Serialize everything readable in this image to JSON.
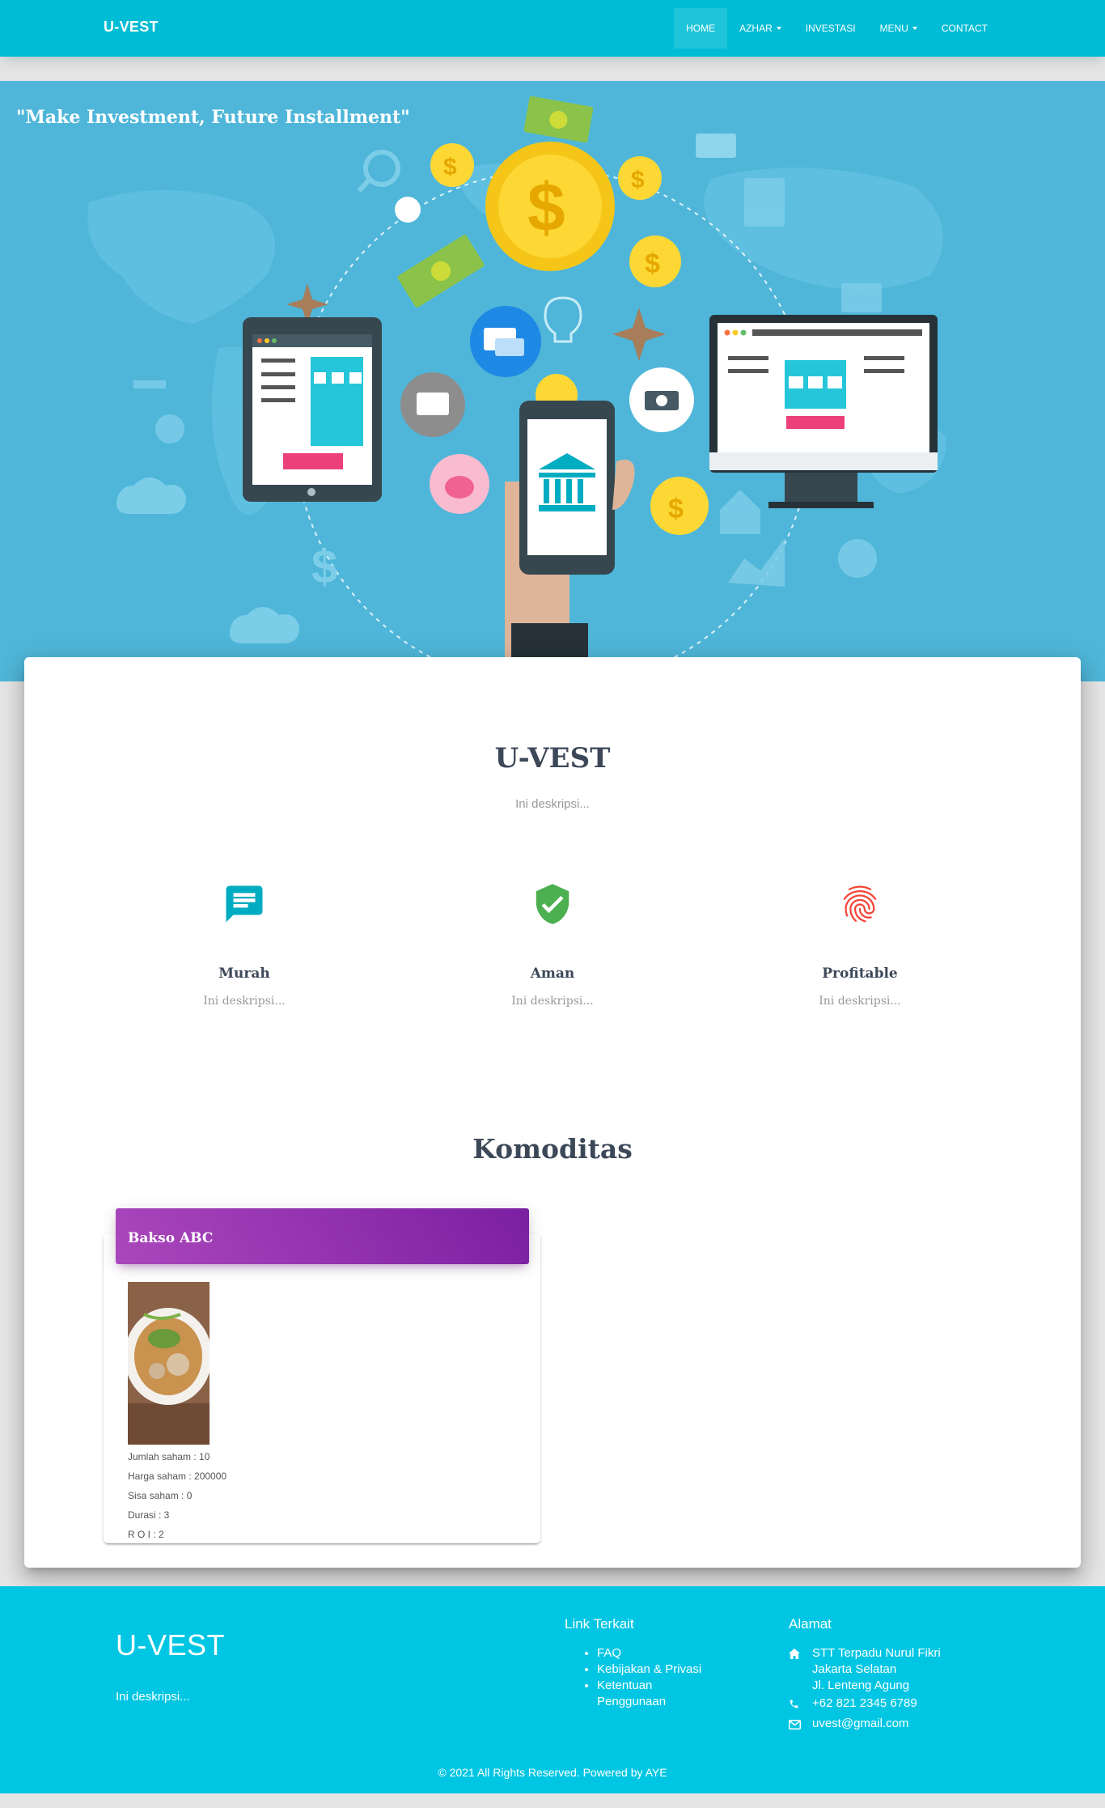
{
  "navbar": {
    "brand": "U-VEST",
    "items": [
      {
        "label": "HOME",
        "active": true,
        "dropdown": false
      },
      {
        "label": "AZHAR",
        "active": false,
        "dropdown": true
      },
      {
        "label": "INVESTASI",
        "active": false,
        "dropdown": false
      },
      {
        "label": "MENU",
        "active": false,
        "dropdown": true
      },
      {
        "label": "CONTACT",
        "active": false,
        "dropdown": false
      }
    ]
  },
  "hero": {
    "quote": "\"Make Investment, Future Installment\""
  },
  "main": {
    "title": "U-VEST",
    "description": "Ini deskripsi...",
    "features": [
      {
        "title": "Murah",
        "description": "Ini deskripsi...",
        "icon": "chat-icon"
      },
      {
        "title": "Aman",
        "description": "Ini deskripsi...",
        "icon": "verified-shield-icon"
      },
      {
        "title": "Profitable",
        "description": "Ini deskripsi...",
        "icon": "fingerprint-icon"
      }
    ],
    "komoditas_title": "Komoditas",
    "products": [
      {
        "name": "Bakso ABC",
        "details": [
          "Jumlah saham : 10",
          "Harga saham : 200000",
          "Sisa saham : 0",
          "Durasi : 3",
          "R O I : 2"
        ]
      }
    ]
  },
  "footer": {
    "brand": "U-VEST",
    "description": "Ini deskripsi...",
    "links_title": "Link Terkait",
    "links": [
      "FAQ",
      "Kebijakan & Privasi",
      "Ketentuan Penggunaan"
    ],
    "address_title": "Alamat",
    "address_lines": [
      "STT Terpadu Nurul Fikri",
      "Jakarta Selatan",
      "Jl. Lenteng Agung"
    ],
    "phone": "+62 821 2345 6789",
    "email": "uvest@gmail.com",
    "copyright": "© 2021 All Rights Reserved. Powered by AYE"
  },
  "colors": {
    "primary": "#00bcd4",
    "footer": "#00c6e3",
    "hero_bg": "#4fb6d9",
    "card_header_start": "#ab47bc",
    "card_header_end": "#7b1fa2",
    "feature_murah": "#00acc1",
    "feature_aman": "#4caf50",
    "feature_profitable": "#f44336"
  }
}
